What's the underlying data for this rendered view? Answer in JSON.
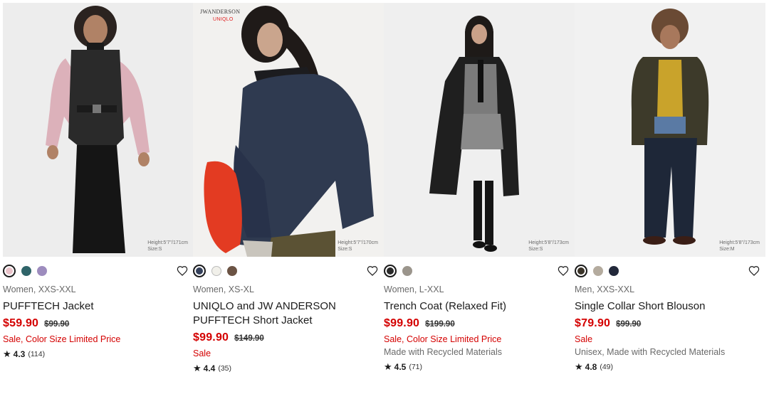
{
  "products": [
    {
      "swatches": [
        "#e9c2c9",
        "#2f6469",
        "#9d8cbe"
      ],
      "selected": 0,
      "size_note": [
        "Height:5'7\"/171cm",
        "Size:S"
      ],
      "meta": "Women, XXS-XXL",
      "name": "PUFFTECH Jacket",
      "price": "$59.90",
      "original_price": "$99.90",
      "promo": "Sale, Color Size Limited Price",
      "extra": "",
      "rating": "4.3",
      "reviews": "(114)"
    },
    {
      "brand_mark": "JWANDERSON",
      "brand_sub": "UNIQLO",
      "swatches": [
        "#34405a",
        "#f1f0ea",
        "#6b5344"
      ],
      "selected": 0,
      "size_note": [
        "Height:5'7\"/170cm",
        "Size:S"
      ],
      "meta": "Women, XS-XL",
      "name": "UNIQLO and JW ANDERSON PUFFTECH Short Jacket",
      "price": "$99.90",
      "original_price": "$149.90",
      "promo": "Sale",
      "extra": "",
      "rating": "4.4",
      "reviews": "(35)"
    },
    {
      "swatches": [
        "#2a2a2a",
        "#9b958c"
      ],
      "selected": 0,
      "size_note": [
        "Height:5'8\"/173cm",
        "Size:S"
      ],
      "meta": "Women, L-XXL",
      "name": "Trench Coat (Relaxed Fit)",
      "price": "$99.90",
      "original_price": "$199.90",
      "promo": "Sale, Color Size Limited Price",
      "extra": "Made with Recycled Materials",
      "rating": "4.5",
      "reviews": "(71)"
    },
    {
      "swatches": [
        "#3a3328",
        "#b4ab9e",
        "#22283a"
      ],
      "selected": 0,
      "size_note": [
        "Height:5'8\"/173cm",
        "Size:M"
      ],
      "meta": "Men, XXS-XXL",
      "name": "Single Collar Short Blouson",
      "price": "$79.90",
      "original_price": "$99.90",
      "promo": "Sale",
      "extra": "Unisex, Made with Recycled Materials",
      "rating": "4.8",
      "reviews": "(49)"
    }
  ],
  "icons": {
    "wishlist": "heart-outline-icon",
    "star": "star-icon"
  },
  "colors": {
    "sale_red": "#d40000",
    "text": "#1b1b1b",
    "muted": "#6a6a6a"
  }
}
